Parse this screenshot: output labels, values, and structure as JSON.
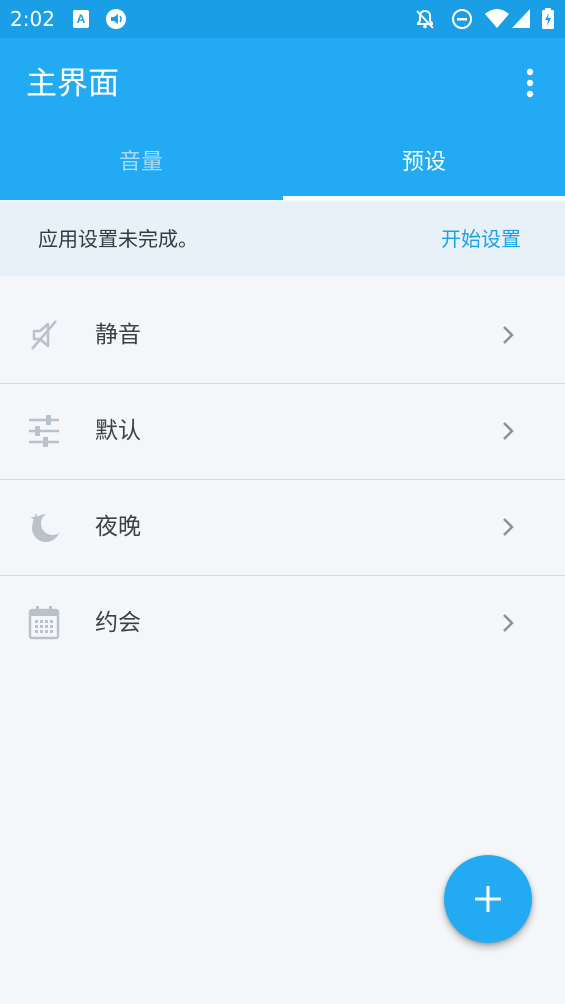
{
  "status_bar": {
    "time": "2:02",
    "icons": [
      "text-a-icon",
      "volume-icon",
      "bell-off-icon",
      "do-not-disturb-icon",
      "wifi-icon",
      "signal-icon",
      "battery-icon"
    ]
  },
  "app_bar": {
    "title": "主界面",
    "menu_icon": "more-vert-icon"
  },
  "tabs": [
    {
      "label": "音量",
      "selected": false
    },
    {
      "label": "预设",
      "selected": true
    }
  ],
  "notice": {
    "message": "应用设置未完成。",
    "action": "开始设置"
  },
  "presets": [
    {
      "label": "静音",
      "icon": "mute-icon"
    },
    {
      "label": "默认",
      "icon": "sliders-icon"
    },
    {
      "label": "夜晚",
      "icon": "night-icon"
    },
    {
      "label": "约会",
      "icon": "calendar-icon"
    }
  ],
  "fab": {
    "icon": "add-icon"
  },
  "colors": {
    "status_bar": "#1a9ee6",
    "app_bar": "#22abf2",
    "accent": "#1aa2e6",
    "background": "#f4f6f9",
    "notice_background": "#e9f1f8"
  }
}
